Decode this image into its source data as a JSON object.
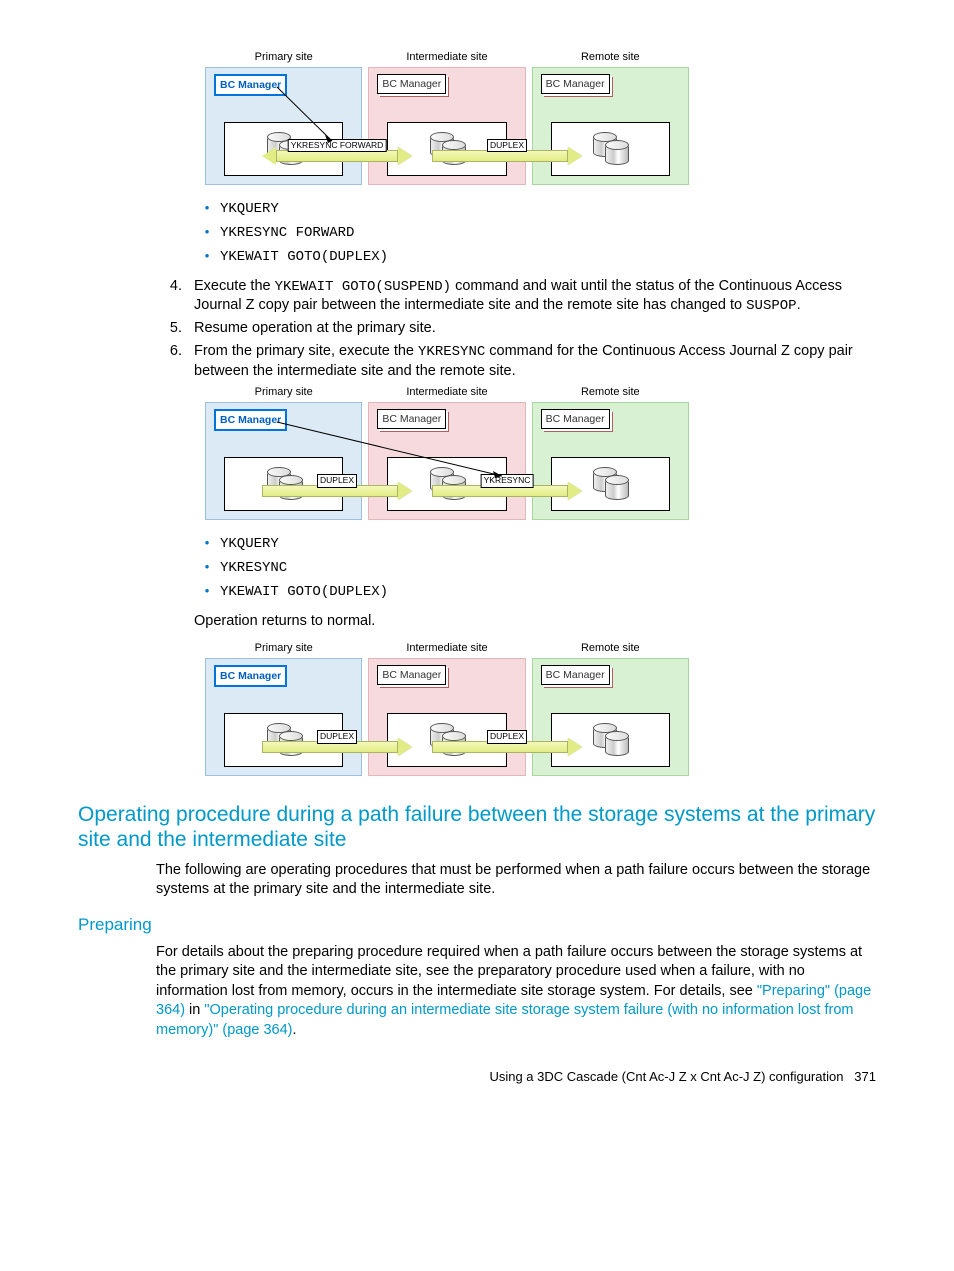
{
  "sites": {
    "primary": "Primary site",
    "intermediate": "Intermediate site",
    "remote": "Remote site"
  },
  "bcm": {
    "active": "BC Manager",
    "inactive": "BC Manager"
  },
  "diagram1": {
    "arrow1_label": "YKRESYNC FORWARD",
    "arrow2_label": "DUPLEX"
  },
  "diagram2": {
    "arrow1_label": "DUPLEX",
    "arrow2_label": "YKRESYNC"
  },
  "diagram3": {
    "arrow1_label": "DUPLEX",
    "arrow2_label": "DUPLEX"
  },
  "bullets1": {
    "b1": "YKQUERY",
    "b2": "YKRESYNC FORWARD",
    "b3": "YKEWAIT GOTO(DUPLEX)"
  },
  "bullets2": {
    "b1": "YKQUERY",
    "b2": "YKRESYNC",
    "b3": "YKEWAIT GOTO(DUPLEX)"
  },
  "step4": {
    "num": "4.",
    "pre": "Execute the ",
    "cmd1": "YKEWAIT GOTO(SUSPEND)",
    "mid": " command and wait until the status of the Continuous Access Journal Z copy pair between the intermediate site and the remote site has changed to ",
    "cmd2": "SUSPOP",
    "post": "."
  },
  "step5": {
    "num": "5.",
    "text": "Resume operation at the primary site."
  },
  "step6": {
    "num": "6.",
    "pre": "From the primary site, execute the ",
    "cmd1": "YKRESYNC",
    "post": " command for the Continuous Access Journal Z copy pair between the intermediate site and the remote site."
  },
  "returns_normal": "Operation returns to normal.",
  "section_heading": "Operating procedure during a path failure between the storage systems at the primary site and the intermediate site",
  "section_para": "The following are operating procedures that must be performed when a path failure occurs between the storage systems at the primary site and the intermediate site.",
  "sub_heading": "Preparing",
  "prep_para": {
    "p1": "For details about the preparing procedure required when a path failure occurs between the storage systems at the primary site and the intermediate site, see the preparatory procedure used when a failure, with no information lost from memory, occurs in the intermediate site storage system. For details, see ",
    "link1": "\"Preparing\" (page 364)",
    "p2": " in ",
    "link2": "\"Operating procedure during an intermediate site storage system failure (with no information lost from memory)\" (page 364)",
    "p3": "."
  },
  "footer": {
    "text": "Using a 3DC Cascade (Cnt Ac-J Z x Cnt Ac-J Z) configuration",
    "page": "371"
  }
}
